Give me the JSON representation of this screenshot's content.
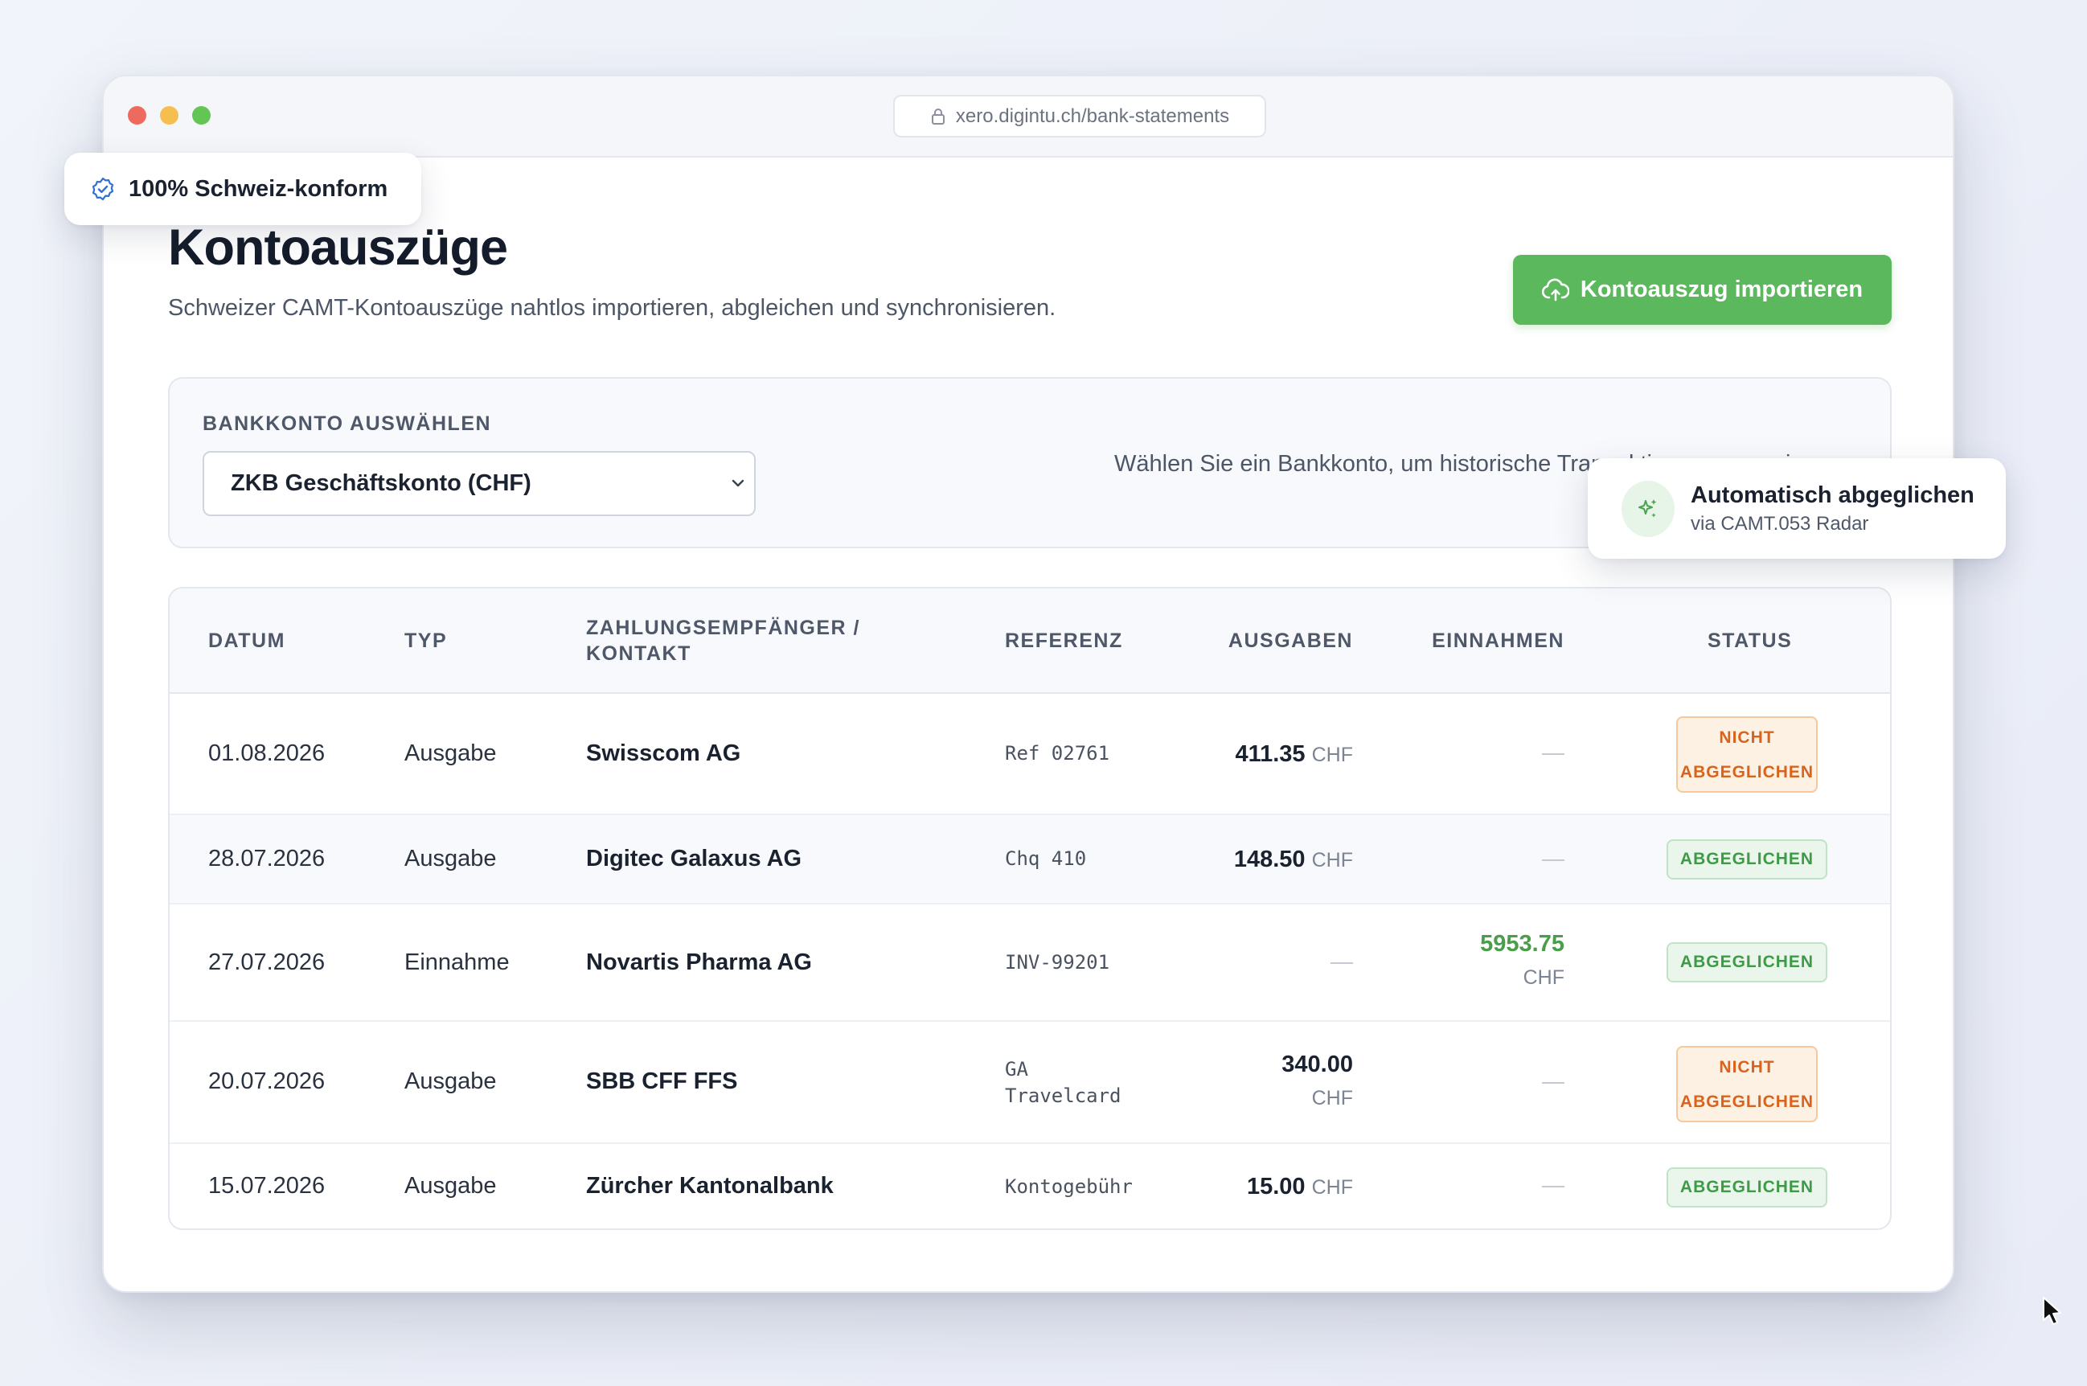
{
  "browser": {
    "url": "xero.digintu.ch/bank-statements"
  },
  "badge": {
    "label": "100% Schweiz-konform",
    "icon": "shield-check-icon"
  },
  "header": {
    "title": "Kontoauszüge",
    "subtitle": "Schweizer CAMT-Kontoauszüge nahtlos importieren, abgleichen und synchronisieren.",
    "import_label": "Kontoauszug importieren",
    "import_icon": "cloud-upload-icon"
  },
  "account": {
    "label": "BANKKONTO AUSWÄHLEN",
    "selected": "ZKB Geschäftskonto (CHF)",
    "hint": "Wählen Sie ein Bankkonto, um historische Transaktionen anzuzeigen."
  },
  "auto_match": {
    "title": "Automatisch abgeglichen",
    "subtitle": "via CAMT.053 Radar",
    "icon": "sparkles-icon"
  },
  "table": {
    "columns": {
      "date": "DATUM",
      "type": "TYP",
      "payee_line1": "ZAHLUNGSEMPFÄNGER /",
      "payee_line2": "KONTAKT",
      "reference": "REFERENZ",
      "expenses": "AUSGABEN",
      "income": "EINNAHMEN",
      "status": "STATUS"
    },
    "rows": [
      {
        "date": "01.08.2026",
        "type": "Ausgabe",
        "payee": "Swisscom AG",
        "ref1": "Ref 02761",
        "ref2": "",
        "expense": "411.35",
        "expense_cur": "CHF",
        "income": "",
        "income_cur": "",
        "status1": "NICHT",
        "status2": "ABGEGLICHEN"
      },
      {
        "date": "28.07.2026",
        "type": "Ausgabe",
        "payee": "Digitec Galaxus AG",
        "ref1": "Chq 410",
        "ref2": "",
        "expense": "148.50",
        "expense_cur": "CHF",
        "income": "",
        "income_cur": "",
        "status1": "ABGEGLICHEN",
        "status2": ""
      },
      {
        "date": "27.07.2026",
        "type": "Einnahme",
        "payee": "Novartis Pharma AG",
        "ref1": "INV-99201",
        "ref2": "",
        "expense": "",
        "expense_cur": "",
        "income": "5953.75",
        "income_cur": "CHF",
        "status1": "ABGEGLICHEN",
        "status2": ""
      },
      {
        "date": "20.07.2026",
        "type": "Ausgabe",
        "payee": "SBB CFF FFS",
        "ref1": "GA",
        "ref2": "Travelcard",
        "expense": "340.00",
        "expense_cur": "CHF",
        "income": "",
        "income_cur": "",
        "status1": "NICHT",
        "status2": "ABGEGLICHEN"
      },
      {
        "date": "15.07.2026",
        "type": "Ausgabe",
        "payee": "Zürcher Kantonalbank",
        "ref1": "Kontogebühr",
        "ref2": "",
        "expense": "15.00",
        "expense_cur": "CHF",
        "income": "",
        "income_cur": "",
        "status1": "ABGEGLICHEN",
        "status2": ""
      }
    ]
  },
  "colors": {
    "accent_green": "#5cb85c",
    "matched_text": "#3f9a48",
    "unmatched_text": "#d9631c",
    "income_text": "#4a9e4a"
  }
}
